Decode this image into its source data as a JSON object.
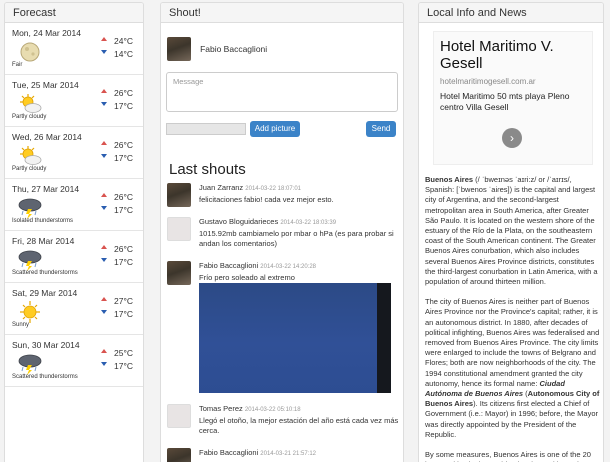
{
  "forecast": {
    "title": "Forecast",
    "days": [
      {
        "date": "Mon, 24 Mar 2014",
        "condition": "Fair",
        "icon": "moon-icon",
        "hi": "24°C",
        "lo": "14°C"
      },
      {
        "date": "Tue, 25 Mar 2014",
        "condition": "Partly cloudy",
        "icon": "partly-cloudy-icon",
        "hi": "26°C",
        "lo": "17°C"
      },
      {
        "date": "Wed, 26 Mar 2014",
        "condition": "Partly cloudy",
        "icon": "partly-cloudy-icon",
        "hi": "26°C",
        "lo": "17°C"
      },
      {
        "date": "Thu, 27 Mar 2014",
        "condition": "Isolated thunderstorms",
        "icon": "thunderstorm-icon",
        "hi": "26°C",
        "lo": "17°C"
      },
      {
        "date": "Fri, 28 Mar 2014",
        "condition": "Scattered thunderstorms",
        "icon": "thunderstorm-icon",
        "hi": "26°C",
        "lo": "17°C"
      },
      {
        "date": "Sat, 29 Mar 2014",
        "condition": "Sunny",
        "icon": "sun-icon",
        "hi": "27°C",
        "lo": "17°C"
      },
      {
        "date": "Sun, 30 Mar 2014",
        "condition": "Scattered thunderstorms",
        "icon": "thunderstorm-icon",
        "hi": "25°C",
        "lo": "17°C"
      }
    ]
  },
  "shout": {
    "title": "Shout!",
    "user_name": "Fabio Baccaglioni",
    "message_placeholder": "Message",
    "add_picture_label": "Add picture",
    "send_label": "Send",
    "last_shouts_title": "Last shouts",
    "items": [
      {
        "author": "Juan Zarranz",
        "time": "2014-03-22 18:07:01",
        "text": "felicitaciones fabio! cada vez mejor esto.",
        "avatar": "photo"
      },
      {
        "author": "Gustavo Bloguidarieces",
        "time": "2014-03-22 18:03:39",
        "text": "1015.92mb cambiamelo por mbar o hPa (es para probar si andan los comentarios)",
        "avatar": "blank"
      },
      {
        "author": "Fabio Baccaglioni",
        "time": "2014-03-22 14:20:28",
        "text": "Frío pero soleado al extremo",
        "avatar": "photo"
      },
      {
        "author": "Tomas Perez",
        "time": "2014-03-22 05:10:18",
        "text": "Llegó el otoño, la mejor estación del año está cada vez más cerca.",
        "avatar": "blank"
      },
      {
        "author": "Fabio Baccaglioni",
        "time": "2014-03-21 21:57:12",
        "text": "",
        "avatar": "photo"
      }
    ]
  },
  "local": {
    "title": "Local Info and News",
    "ad_title": "Hotel Maritimo V. Gesell",
    "ad_url": "hotelmaritimogesell.com.ar",
    "ad_body": "Hotel Maritimo 50 mts playa Pleno centro Villa Gesell",
    "p1_bold": "Buenos Aires",
    "p1": " (/ ˈbweɪnəs ˈaɪri:z/ or /ˈaɪrɪs/, Spanish: [ˈbwenos ˈaiɾes]) is the capital and largest city of Argentina, and the second-largest metropolitan area in South America, after Greater São Paulo. It is located on the western shore of the estuary of the Río de la Plata, on the southeastern coast of the South American continent. The Greater Buenos Aires conurbation, which also includes several Buenos Aires Province districts, constitutes the third-largest conurbation in Latin America, with a population of around thirteen million.",
    "p2a": "The city of Buenos Aires is neither part of Buenos Aires Province nor the Province's capital; rather, it is an autonomous district. In 1880, after decades of political infighting, Buenos Aires was federalised and removed from Buenos Aires Province. The city limits were enlarged to include the towns of Belgrano and Flores; both are now neighborhoods of the city. The 1994 constitutional amendment granted the city autonomy, hence its formal name: ",
    "p2_italic": "Ciudad Autónoma de Buenos Aires",
    "p2_open": " (",
    "p2_bold": "Autonomous City of Buenos Aires",
    "p2b": "). Its citizens first elected a Chief of Government (i.e.: Mayor) in 1996; before, the Mayor was directly appointed by the President of the Republic.",
    "p3": "By some measures, Buenos Aires is one of the 20 largest cities in the world. It is, along with Mexico"
  },
  "colors": {
    "accent": "#3b83c8",
    "up": "#d9534f",
    "down": "#2a5db0"
  }
}
